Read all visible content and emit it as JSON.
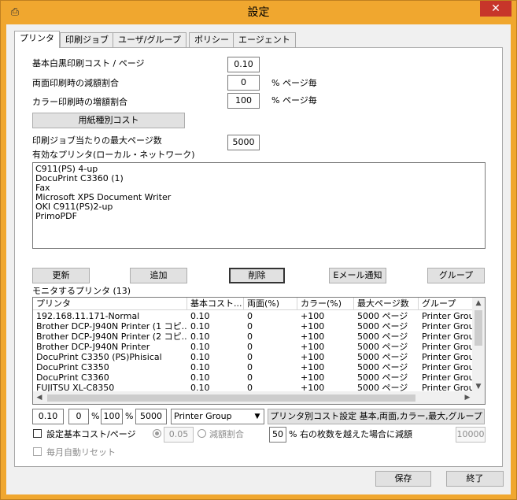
{
  "window": {
    "title": "設定",
    "close_glyph": "✕",
    "icon_glyph": "⎙"
  },
  "tabs": [
    "プリンタ",
    "印刷ジョブ",
    "ユーザ/グループ",
    "ポリシー",
    "エージェント"
  ],
  "settings": {
    "base_cost_label": "基本白黒印刷コスト / ページ",
    "base_cost_value": "0.10",
    "duplex_label": "両面印刷時の減額割合",
    "duplex_value": "0",
    "duplex_unit": "% ページ毎",
    "color_label": "カラー印刷時の増額割合",
    "color_value": "100",
    "color_unit": "% ページ毎",
    "paper_cost_button": "用紙種別コスト",
    "max_pages_label": "印刷ジョブ当たりの最大ページ数",
    "max_pages_value": "5000",
    "valid_printers_label": "有効なプリンタ(ローカル・ネットワーク)"
  },
  "valid_printers": [
    "C911(PS) 4-up",
    "DocuPrint C3360 (1)",
    "Fax",
    "Microsoft XPS Document Writer",
    "OKI C911(PS)2-up",
    "PrimoPDF"
  ],
  "actions": {
    "refresh": "更新",
    "add": "追加",
    "delete": "削除",
    "email": "Eメール通知",
    "group": "グループ"
  },
  "monitor": {
    "label": "モニタするプリンタ (13)",
    "columns": [
      "プリンタ",
      "基本コスト...",
      "両面(%)",
      "カラー(%)",
      "最大ページ数",
      "グループ"
    ],
    "rows": [
      [
        "192.168.11.171-Normal",
        "0.10",
        "0",
        "+100",
        "5000 ページ",
        "Printer Grou"
      ],
      [
        "Brother DCP-J940N Printer (1 コピ...",
        "0.10",
        "0",
        "+100",
        "5000 ページ",
        "Printer Grou"
      ],
      [
        "Brother DCP-J940N Printer (2 コピ...",
        "0.10",
        "0",
        "+100",
        "5000 ページ",
        "Printer Grou"
      ],
      [
        "Brother DCP-J940N Printer",
        "0.10",
        "0",
        "+100",
        "5000 ページ",
        "Printer Grou"
      ],
      [
        "DocuPrint C3350 (PS)Phisical",
        "0.10",
        "0",
        "+100",
        "5000 ページ",
        "Printer Grou"
      ],
      [
        "DocuPrint C3350",
        "0.10",
        "0",
        "+100",
        "5000 ページ",
        "Printer Grou"
      ],
      [
        "DocuPrint C3360",
        "0.10",
        "0",
        "+100",
        "5000 ページ",
        "Printer Grou"
      ],
      [
        "FUJITSU XL-C8350",
        "0.10",
        "0",
        "+100",
        "5000 ページ",
        "Printer Grou"
      ]
    ]
  },
  "edit_row": {
    "cost": "0.10",
    "duplex": "0",
    "duplex_unit": "%",
    "color": "100",
    "color_unit": "%",
    "max": "5000",
    "group_selected": "Printer Group",
    "per_printer_button": "プリンタ別コスト設定 基本,両面,カラー,最大,グループ"
  },
  "options": {
    "set_base_cost_label": "設定基本コスト/ページ",
    "radio_value": "0.05",
    "reduction_label": "減額割合",
    "threshold_value": "50",
    "threshold_label": "% 右の枚数を越えた場合に減額",
    "page_count_value": "10000",
    "monthly_reset_label": "毎月自動リセット"
  },
  "footer": {
    "save": "保存",
    "exit": "終了"
  }
}
